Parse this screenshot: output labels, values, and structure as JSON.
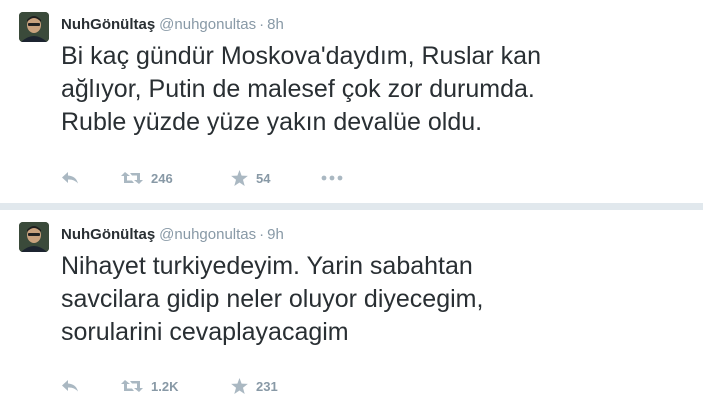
{
  "tweets": [
    {
      "display_name": "NuhGönültaş",
      "handle": "@nuhgonultas",
      "separator": "·",
      "time": "8h",
      "text": "Bi kaç gündür Moskova'daydım, Ruslar kan\nağlıyor, Putin de malesef çok zor durumda.\nRuble yüzde yüze yakın devalüe oldu.",
      "retweets": "246",
      "favorites": "54"
    },
    {
      "display_name": "NuhGönültaş",
      "handle": "@nuhgonultas",
      "separator": "·",
      "time": "9h",
      "text": "Nihayet turkiyedeyim. Yarin sabahtan\nsavcilara gidip neler oluyor diyecegim,\nsorularini cevaplayacagim",
      "retweets": "1.2K",
      "favorites": "231"
    }
  ],
  "icons": {
    "reply": "reply-arrow-icon",
    "retweet": "retweet-icon",
    "favorite": "star-icon",
    "more": "ellipsis-icon"
  },
  "colors": {
    "text": "#292f33",
    "muted": "#8899a6",
    "divider": "#e1e8ed"
  }
}
